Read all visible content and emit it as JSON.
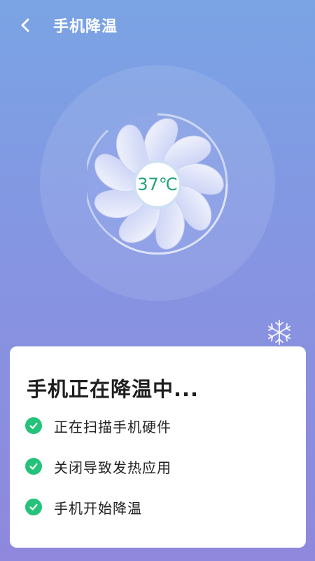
{
  "header": {
    "title": "手机降温",
    "back_icon": "chevron-left-icon"
  },
  "fan": {
    "temperature": "37℃",
    "icon": "fan-icon"
  },
  "decor": {
    "snow_icon": "snowflake-icon"
  },
  "card": {
    "title": "手机正在降温中...",
    "steps": [
      {
        "label": "正在扫描手机硬件",
        "status": "done",
        "icon": "check-circle-icon"
      },
      {
        "label": "关闭导致发热应用",
        "status": "done",
        "icon": "check-circle-icon"
      },
      {
        "label": "手机开始降温",
        "status": "done",
        "icon": "check-circle-icon"
      }
    ]
  },
  "colors": {
    "background_top": "#7aa4e4",
    "background_bottom": "#8f88dc",
    "accent_green": "#25c27a",
    "temperature_text": "#21a27a"
  }
}
